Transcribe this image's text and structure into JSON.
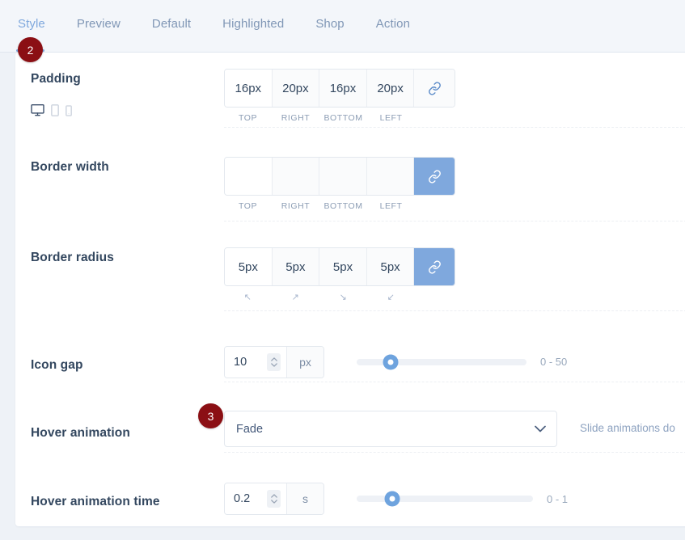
{
  "tabs": [
    {
      "label": "Style",
      "active": true
    },
    {
      "label": "Preview",
      "active": false
    },
    {
      "label": "Default",
      "active": false
    },
    {
      "label": "Highlighted",
      "active": false
    },
    {
      "label": "Shop",
      "active": false
    },
    {
      "label": "Action",
      "active": false
    }
  ],
  "badges": [
    {
      "id": "badge-2",
      "text": "2"
    },
    {
      "id": "badge-3",
      "text": "3"
    }
  ],
  "colors": {
    "accent_blue": "#7fa8dd",
    "badge_red": "#8b0f14",
    "label_navy": "#33475f",
    "page_bg": "#eef2f7"
  },
  "rows": {
    "padding": {
      "label": "Padding",
      "devices": [
        "desktop-icon",
        "tablet-icon",
        "mobile-icon"
      ],
      "active_device": "desktop-icon",
      "values": [
        "16px",
        "20px",
        "16px",
        "20px"
      ],
      "sublabels": [
        "TOP",
        "RIGHT",
        "BOTTOM",
        "LEFT"
      ],
      "link_icon": "link-icon",
      "linked": false
    },
    "border_width": {
      "label": "Border width",
      "values": [
        "",
        "",
        "",
        ""
      ],
      "sublabels": [
        "TOP",
        "RIGHT",
        "BOTTOM",
        "LEFT"
      ],
      "link_icon": "link-icon",
      "linked": true
    },
    "border_radius": {
      "label": "Border radius",
      "values": [
        "5px",
        "5px",
        "5px",
        "5px"
      ],
      "sublabels": [
        "↖",
        "↗",
        "↘",
        "↙"
      ],
      "corner_names": [
        "corner-top-left-icon",
        "corner-top-right-icon",
        "corner-bottom-right-icon",
        "corner-bottom-left-icon"
      ],
      "link_icon": "link-icon",
      "linked": true
    },
    "icon_gap": {
      "label": "Icon gap",
      "value": "10",
      "unit": "px",
      "range": "0 - 50",
      "slider_percent": 20
    },
    "hover_animation": {
      "label": "Hover animation",
      "value": "Fade",
      "chevron": "chevron-down-icon",
      "help": "Slide animations do"
    },
    "hover_animation_time": {
      "label": "Hover animation time",
      "value": "0.2",
      "unit": "s",
      "range": "0 - 1",
      "slider_percent": 20
    }
  }
}
